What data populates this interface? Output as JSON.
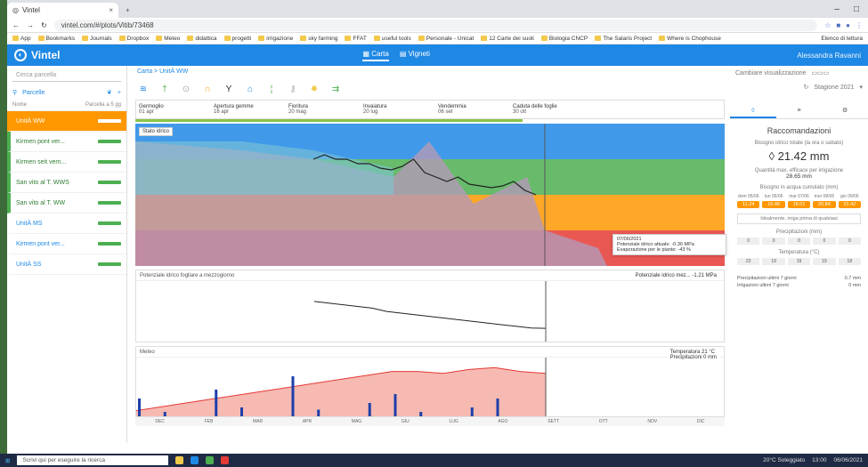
{
  "browser": {
    "tab_title": "Vintel",
    "url": "vintel.com/#/plots/Vitib/73468",
    "bookmarks": [
      "App",
      "Bookmarks",
      "Journals",
      "Dropbox",
      "Meteo",
      "didattica",
      "progetti",
      "irrigazione",
      "sky farming",
      "FFAT",
      "useful tools",
      "Personale - Unicat",
      "12 Carte dei suoli",
      "Biologia CNCP",
      "The Salaris Project",
      "Where is Chophouse"
    ],
    "other_bookmarks": "Elenco di lettura"
  },
  "app": {
    "name": "Vintel",
    "tabs": [
      {
        "label": "Carta",
        "active": true
      },
      {
        "label": "Vigneti",
        "active": false
      }
    ],
    "user": "Alessandra Ravanni"
  },
  "sidebar": {
    "search_placeholder": "Cerca parcella",
    "parcel_label": "Parcelle",
    "col_name": "Nome",
    "col_stress": "Parcella a 5 gg",
    "fields": [
      {
        "name": "UnitÀ WW",
        "selected": true
      },
      {
        "name": "Kirmen pont ver...",
        "selected": false
      },
      {
        "name": "Kirmen seit vern...",
        "selected": false
      },
      {
        "name": "San vito al T. WWS",
        "selected": false
      },
      {
        "name": "San vito al T. WW",
        "selected": false
      },
      {
        "name": "UnitÀ MS",
        "selected": false
      },
      {
        "name": "Kirmen pont ver...",
        "selected": false
      },
      {
        "name": "UnitÀ SS",
        "selected": false
      }
    ]
  },
  "main": {
    "breadcrumb": "Carta > UnitÀ WW",
    "stages": [
      {
        "name": "Germoglio",
        "date": "01 apr"
      },
      {
        "name": "Apertura gemme",
        "date": "16 apr"
      },
      {
        "name": "Fioritura",
        "date": "20 mag"
      },
      {
        "name": "Invaiatura",
        "date": "20 lug"
      },
      {
        "name": "Vendemmia",
        "date": "06 set"
      },
      {
        "name": "Caduta delle foglie",
        "date": "30 ott"
      }
    ],
    "panelA_label": "Stato idrico",
    "tooltip": {
      "date": "07/06/2021",
      "line1": "Potenziale idrico attuale: -0.30 MPa",
      "line2": "Evaporazione per le piante: -43 %"
    },
    "panelB_title": "Potenziale idrico fogliare a mezzogiorno",
    "panelB_legend": "Potenziale idrico mez... -1.21 MPa",
    "panelC_title": "Meteo",
    "panelC_legend": [
      {
        "label": "Temperatura",
        "value": "21 °C"
      },
      {
        "label": "Precipitazioni",
        "value": "0 mm"
      }
    ],
    "months": [
      "DEC",
      "FEB",
      "MAR",
      "APR",
      "MAG",
      "GIU",
      "LUG",
      "AGO",
      "SETT",
      "OTT",
      "NOV",
      "DIC"
    ]
  },
  "chart_data": [
    {
      "type": "line",
      "title": "Stato idrico",
      "series": [
        {
          "name": "Potenziale idrico attuale",
          "values": [
            -0.3,
            -0.25,
            -0.3,
            -0.3,
            -0.35,
            -0.35,
            -0.4,
            -0.42,
            -0.38,
            -0.3,
            -0.45,
            -0.5,
            -0.55,
            -0.5,
            -0.58,
            -0.6,
            -0.62,
            -0.6,
            -0.55,
            -0.65,
            -0.7
          ]
        }
      ],
      "bands": [
        "#1e88e5",
        "#4caf50",
        "#ff9800",
        "#e53935"
      ]
    },
    {
      "type": "line",
      "title": "Potenziale idrico fogliare a mezzogiorno",
      "series": [
        {
          "name": "Potenziale idrico mez...",
          "values": [
            -0.4,
            -0.45,
            -0.5,
            -0.55,
            -0.6,
            -0.7,
            -0.75,
            -0.8,
            -0.85,
            -0.9,
            -0.95,
            -1.0,
            -1.05,
            -1.1,
            -1.15,
            -1.2,
            -1.21
          ]
        }
      ],
      "ylim": [
        -1.5,
        0
      ]
    },
    {
      "type": "area",
      "title": "Meteo",
      "series": [
        {
          "name": "Temperatura",
          "values": [
            2,
            4,
            6,
            8,
            10,
            12,
            14,
            16,
            18,
            20,
            22,
            22,
            21,
            23,
            24,
            22,
            21
          ]
        },
        {
          "name": "Precipitazioni",
          "values": [
            8,
            2,
            0,
            12,
            4,
            0,
            18,
            3,
            0,
            6,
            10,
            2,
            0,
            4,
            8,
            0,
            0
          ]
        }
      ]
    }
  ],
  "right": {
    "overview_label": "Cambiare visualizzazione",
    "season": "Stagione 2021",
    "reco_title": "Raccomandazioni",
    "need_label": "Bisogno idrico totale (la ora o sabato)",
    "need_value": "21.42 mm",
    "eff_label": "Quantità max. efficace per irrigazione",
    "eff_value": "28.65 mm",
    "water_label": "Bisogno in acqua cumulato (mm)",
    "days": [
      {
        "d": "dom 05/06",
        "v": "11.24"
      },
      {
        "d": "lun 06/06",
        "v": "16.46"
      },
      {
        "d": "mar 07/06",
        "v": "18.01"
      },
      {
        "d": "mer 08/06",
        "v": "20.84"
      },
      {
        "d": "gio 09/06",
        "v": "21.42"
      }
    ],
    "ghost_btn": "Idealmente, irriga prima di qualsiasi",
    "precip_label": "Precipitazioni (mm)",
    "temp_label": "Temperatura (°C)",
    "precip_vals": [
      "0",
      "0",
      "0",
      "0",
      "0"
    ],
    "temp_vals": [
      "22",
      "19",
      "19",
      "19",
      "18"
    ],
    "last7_precip": "Precipitazioni ultimi 7 giorni",
    "last7_precip_v": "0.7 mm",
    "last7_irr": "Irrigazioni ultimi 7 giorni",
    "last7_irr_v": "0 mm"
  },
  "taskbar": {
    "search": "Scrivi qui per eseguire la ricerca",
    "weather": "20°C Soleggiato",
    "time": "13:00",
    "date": "06/06/2021"
  }
}
